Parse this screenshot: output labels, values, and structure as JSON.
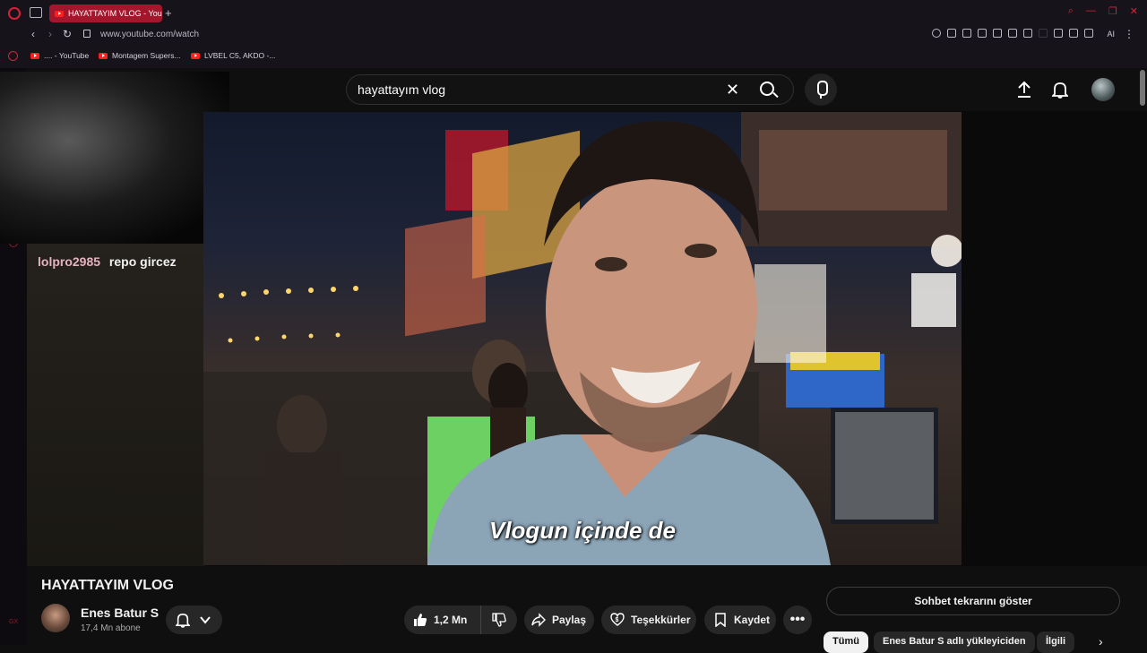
{
  "browser": {
    "tab_title": "HAYATTAYIM VLOG - YouTube",
    "url": "www.youtube.com/watch",
    "ai_label": "AI",
    "bookmarks": [
      {
        "label": ".... - YouTube"
      },
      {
        "label": "Montagem Supers..."
      },
      {
        "label": "LVBEL C5, AKDO -..."
      }
    ],
    "side_label": "GX"
  },
  "youtube": {
    "search_query": "hayattayım vlog",
    "chat": [
      {
        "user": "lolpro2985",
        "message": "repo gircez"
      }
    ],
    "subtitle": "Vlogun içinde de",
    "video_title": "HAYATTAYIM VLOG",
    "channel": {
      "name": "Enes Batur S",
      "subscribers": "17,4 Mn abone"
    },
    "actions": {
      "likes": "1,2 Mn",
      "share": "Paylaş",
      "thanks": "Teşekkürler",
      "save": "Kaydet"
    },
    "chat_replay_button": "Sohbet tekrarını göster",
    "chips": [
      "Tümü",
      "Enes Batur S adlı yükleyiciden",
      "İlgili"
    ]
  },
  "colors": {
    "opera_red": "#d6223a",
    "tab_active": "#a3162c",
    "yt_bg": "#0f0f0f"
  }
}
